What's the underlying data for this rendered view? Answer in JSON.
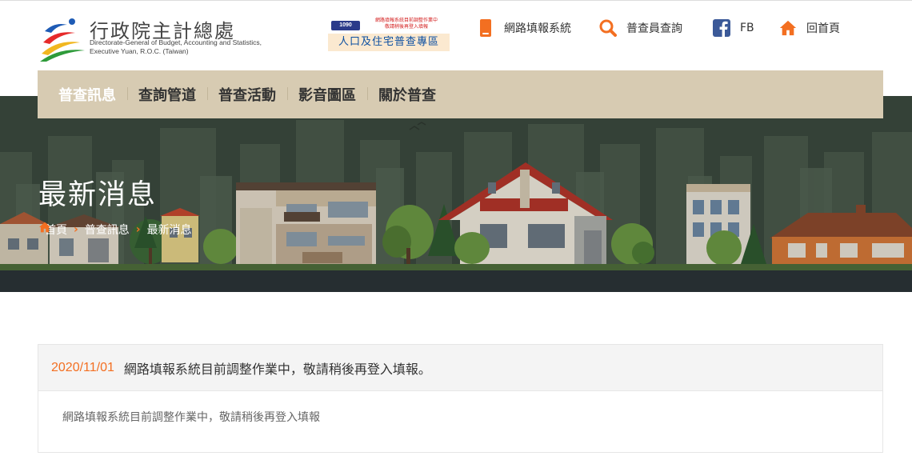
{
  "header": {
    "logo_title": "行政院主計總處",
    "logo_sub_line1": "Directorate-General of Budget, Accounting and Statistics,",
    "logo_sub_line2": "Executive Yuan, R.O.C. (Taiwan)",
    "promo_badge": "1090",
    "promo_small_line1": "網路填報系統目前調整作業中",
    "promo_small_line2": "敬請稍後再登入填報",
    "promo_label": "人口及住宅普查專區",
    "links": [
      {
        "label": "網路填報系統",
        "icon": "phone-icon"
      },
      {
        "label": "普查員查詢",
        "icon": "search-icon"
      },
      {
        "label": "FB",
        "icon": "facebook-icon"
      },
      {
        "label": "回首頁",
        "icon": "home-icon"
      }
    ],
    "colors": {
      "accent": "#f36f21",
      "facebook": "#3b5998",
      "promo_text": "#0b4fa1"
    }
  },
  "nav": {
    "items": [
      {
        "label": "普查訊息",
        "active": true
      },
      {
        "label": "查詢管道",
        "active": false
      },
      {
        "label": "普查活動",
        "active": false
      },
      {
        "label": "影音圖區",
        "active": false
      },
      {
        "label": "關於普查",
        "active": false
      }
    ],
    "background": "#d7cbb2"
  },
  "banner": {
    "title": "最新消息",
    "breadcrumb": [
      "首頁",
      "普查訊息",
      "最新消息"
    ]
  },
  "news": {
    "date": "2020/11/01",
    "title": "網路填報系統目前調整作業中，敬請稍後再登入填報。",
    "body": "網路填報系統目前調整作業中，敬請稍後再登入填報"
  }
}
